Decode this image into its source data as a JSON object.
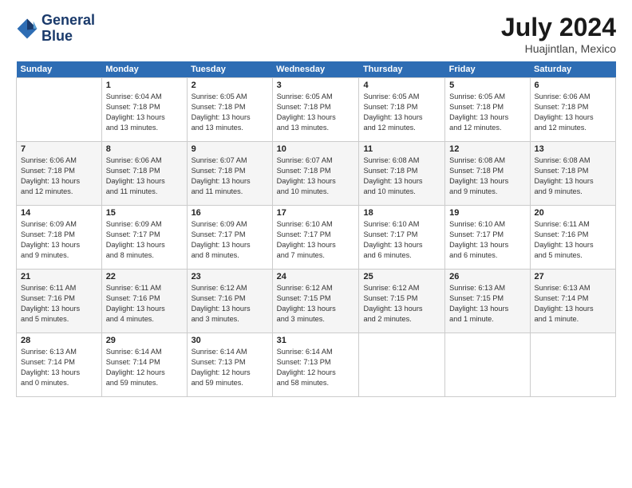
{
  "logo": {
    "line1": "General",
    "line2": "Blue"
  },
  "header": {
    "month": "July 2024",
    "location": "Huajintlan, Mexico"
  },
  "columns": [
    "Sunday",
    "Monday",
    "Tuesday",
    "Wednesday",
    "Thursday",
    "Friday",
    "Saturday"
  ],
  "weeks": [
    [
      {
        "day": "",
        "info": ""
      },
      {
        "day": "1",
        "info": "Sunrise: 6:04 AM\nSunset: 7:18 PM\nDaylight: 13 hours\nand 13 minutes."
      },
      {
        "day": "2",
        "info": "Sunrise: 6:05 AM\nSunset: 7:18 PM\nDaylight: 13 hours\nand 13 minutes."
      },
      {
        "day": "3",
        "info": "Sunrise: 6:05 AM\nSunset: 7:18 PM\nDaylight: 13 hours\nand 13 minutes."
      },
      {
        "day": "4",
        "info": "Sunrise: 6:05 AM\nSunset: 7:18 PM\nDaylight: 13 hours\nand 12 minutes."
      },
      {
        "day": "5",
        "info": "Sunrise: 6:05 AM\nSunset: 7:18 PM\nDaylight: 13 hours\nand 12 minutes."
      },
      {
        "day": "6",
        "info": "Sunrise: 6:06 AM\nSunset: 7:18 PM\nDaylight: 13 hours\nand 12 minutes."
      }
    ],
    [
      {
        "day": "7",
        "info": "Sunrise: 6:06 AM\nSunset: 7:18 PM\nDaylight: 13 hours\nand 12 minutes."
      },
      {
        "day": "8",
        "info": "Sunrise: 6:06 AM\nSunset: 7:18 PM\nDaylight: 13 hours\nand 11 minutes."
      },
      {
        "day": "9",
        "info": "Sunrise: 6:07 AM\nSunset: 7:18 PM\nDaylight: 13 hours\nand 11 minutes."
      },
      {
        "day": "10",
        "info": "Sunrise: 6:07 AM\nSunset: 7:18 PM\nDaylight: 13 hours\nand 10 minutes."
      },
      {
        "day": "11",
        "info": "Sunrise: 6:08 AM\nSunset: 7:18 PM\nDaylight: 13 hours\nand 10 minutes."
      },
      {
        "day": "12",
        "info": "Sunrise: 6:08 AM\nSunset: 7:18 PM\nDaylight: 13 hours\nand 9 minutes."
      },
      {
        "day": "13",
        "info": "Sunrise: 6:08 AM\nSunset: 7:18 PM\nDaylight: 13 hours\nand 9 minutes."
      }
    ],
    [
      {
        "day": "14",
        "info": "Sunrise: 6:09 AM\nSunset: 7:18 PM\nDaylight: 13 hours\nand 9 minutes."
      },
      {
        "day": "15",
        "info": "Sunrise: 6:09 AM\nSunset: 7:17 PM\nDaylight: 13 hours\nand 8 minutes."
      },
      {
        "day": "16",
        "info": "Sunrise: 6:09 AM\nSunset: 7:17 PM\nDaylight: 13 hours\nand 8 minutes."
      },
      {
        "day": "17",
        "info": "Sunrise: 6:10 AM\nSunset: 7:17 PM\nDaylight: 13 hours\nand 7 minutes."
      },
      {
        "day": "18",
        "info": "Sunrise: 6:10 AM\nSunset: 7:17 PM\nDaylight: 13 hours\nand 6 minutes."
      },
      {
        "day": "19",
        "info": "Sunrise: 6:10 AM\nSunset: 7:17 PM\nDaylight: 13 hours\nand 6 minutes."
      },
      {
        "day": "20",
        "info": "Sunrise: 6:11 AM\nSunset: 7:16 PM\nDaylight: 13 hours\nand 5 minutes."
      }
    ],
    [
      {
        "day": "21",
        "info": "Sunrise: 6:11 AM\nSunset: 7:16 PM\nDaylight: 13 hours\nand 5 minutes."
      },
      {
        "day": "22",
        "info": "Sunrise: 6:11 AM\nSunset: 7:16 PM\nDaylight: 13 hours\nand 4 minutes."
      },
      {
        "day": "23",
        "info": "Sunrise: 6:12 AM\nSunset: 7:16 PM\nDaylight: 13 hours\nand 3 minutes."
      },
      {
        "day": "24",
        "info": "Sunrise: 6:12 AM\nSunset: 7:15 PM\nDaylight: 13 hours\nand 3 minutes."
      },
      {
        "day": "25",
        "info": "Sunrise: 6:12 AM\nSunset: 7:15 PM\nDaylight: 13 hours\nand 2 minutes."
      },
      {
        "day": "26",
        "info": "Sunrise: 6:13 AM\nSunset: 7:15 PM\nDaylight: 13 hours\nand 1 minute."
      },
      {
        "day": "27",
        "info": "Sunrise: 6:13 AM\nSunset: 7:14 PM\nDaylight: 13 hours\nand 1 minute."
      }
    ],
    [
      {
        "day": "28",
        "info": "Sunrise: 6:13 AM\nSunset: 7:14 PM\nDaylight: 13 hours\nand 0 minutes."
      },
      {
        "day": "29",
        "info": "Sunrise: 6:14 AM\nSunset: 7:14 PM\nDaylight: 12 hours\nand 59 minutes."
      },
      {
        "day": "30",
        "info": "Sunrise: 6:14 AM\nSunset: 7:13 PM\nDaylight: 12 hours\nand 59 minutes."
      },
      {
        "day": "31",
        "info": "Sunrise: 6:14 AM\nSunset: 7:13 PM\nDaylight: 12 hours\nand 58 minutes."
      },
      {
        "day": "",
        "info": ""
      },
      {
        "day": "",
        "info": ""
      },
      {
        "day": "",
        "info": ""
      }
    ]
  ]
}
